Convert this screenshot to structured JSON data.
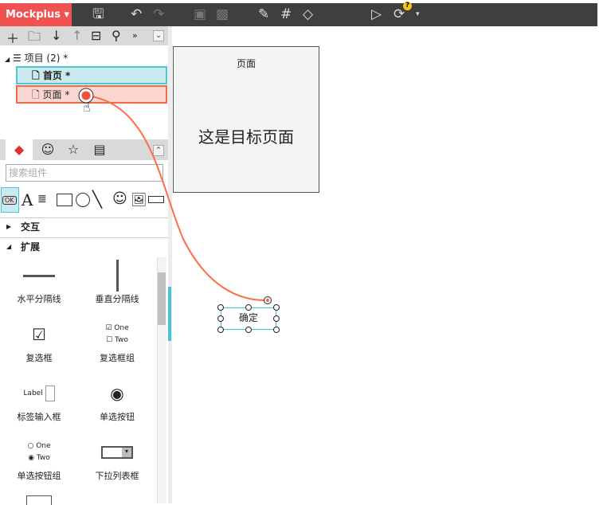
{
  "app": {
    "logo": "Mockplus",
    "logo_caret": "▾"
  },
  "toolbar": {
    "icons": [
      "save-icon",
      "undo-icon",
      "redo-icon",
      "group-icon",
      "ungroup-icon",
      "format-brush-icon",
      "grid-icon",
      "fill-icon",
      "preview-icon",
      "sync-icon"
    ],
    "help_badge": "?"
  },
  "project_toolbar": {
    "more": "»",
    "collapse": "¥"
  },
  "tree": {
    "root": "项目 (2)",
    "root_mark": "*",
    "pages": [
      {
        "label": "首页",
        "mark": "*"
      },
      {
        "label": "页面",
        "mark": "*"
      }
    ]
  },
  "component_panel": {
    "search_placeholder": "搜索组件",
    "widget_ok": "OK",
    "widget_text": "A",
    "sections": [
      {
        "label": "交互",
        "expanded": false
      },
      {
        "label": "扩展",
        "expanded": true
      }
    ],
    "components": [
      "水平分隔线",
      "垂直分隔线",
      "复选框",
      "复选框组",
      "标签输入框",
      "单选按钮",
      "单选按钮组",
      "下拉列表框"
    ],
    "sample": {
      "one": "One",
      "two": "Two",
      "label": "Label"
    }
  },
  "canvas": {
    "frame_title": "页面",
    "frame_text": "这是目标页面",
    "button_label": "确定"
  },
  "colors": {
    "accent": "#f05252",
    "link": "#ff6e4a",
    "selection": "#3bc4d0"
  }
}
